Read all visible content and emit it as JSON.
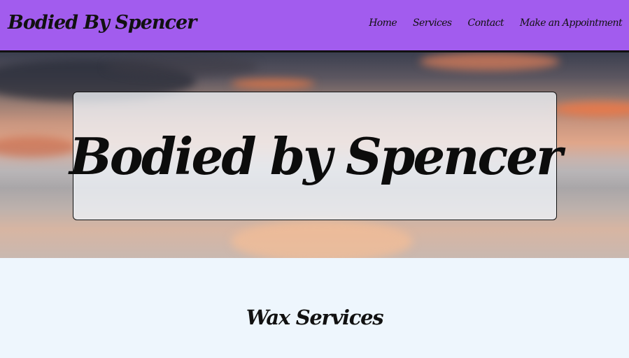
{
  "navbar": {
    "brand": "Bodied By Spencer",
    "links": [
      {
        "label": "Home"
      },
      {
        "label": "Services"
      },
      {
        "label": "Contact"
      },
      {
        "label": "Make an Appointment"
      }
    ]
  },
  "hero": {
    "title": "Bodied by Spencer"
  },
  "services": {
    "heading": "Wax Services"
  },
  "colors": {
    "navbar_bg": "#a25cee",
    "section_bg": "#eef6fd",
    "text": "#111111"
  }
}
